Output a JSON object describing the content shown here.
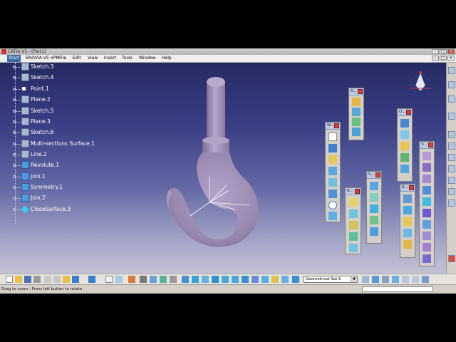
{
  "window": {
    "title": "CATIA V5 - [Part1]"
  },
  "menubar": {
    "items": [
      "Start",
      "ENOVIA V5 VPM",
      "File",
      "Edit",
      "View",
      "Insert",
      "Tools",
      "Window",
      "Help"
    ]
  },
  "tree": {
    "nodes": [
      "Sketch.3",
      "Sketch.4",
      "Point.1",
      "Plane.2",
      "Sketch.5",
      "Plane.3",
      "Sketch.6",
      "Multi-sections Surface.1",
      "Line.2",
      "Revolute.1",
      "Join.1",
      "Symmetry.1",
      "Join.2",
      "CloseSurface.3"
    ]
  },
  "palettes": [
    {
      "title": "A..."
    },
    {
      "title": "W..."
    },
    {
      "title": "O..."
    },
    {
      "title": "V..."
    },
    {
      "title": "B..."
    },
    {
      "title": "S..."
    },
    {
      "title": "R..."
    }
  ],
  "toolbar": {
    "geometrical_set": "Geometrical Set.1"
  },
  "status": {
    "text": "Drag to zoom . Press left button to rotate"
  },
  "colors": {
    "part": "#9b88b3",
    "background_top": "#262a62",
    "background_bottom": "#c4c1d3",
    "axis": "#ffffff"
  }
}
